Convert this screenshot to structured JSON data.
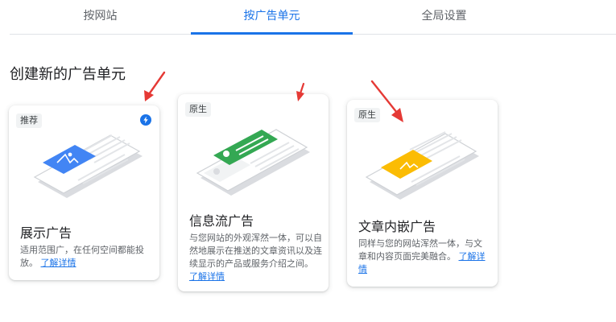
{
  "tabs": [
    {
      "label": "按网站"
    },
    {
      "label": "按广告单元"
    },
    {
      "label": "全局设置"
    }
  ],
  "section_title": "创建新的广告单元",
  "cards": [
    {
      "badge": "推荐",
      "title": "展示广告",
      "desc": "适用范围广，在任何空间都能投放。",
      "link": "了解详情",
      "icon": "lightning-bolt-icon"
    },
    {
      "badge": "原生",
      "title": "信息流广告",
      "desc": "与您网站的外观浑然一体，可以自然地展示在推送的文章资讯以及连续显示的产品或服务介绍之间。",
      "link": "了解详情"
    },
    {
      "badge": "原生",
      "title": "文章内嵌广告",
      "desc": "同样与您的网站浑然一体，与文章和内容页面完美融合。",
      "link": "了解详情"
    }
  ],
  "colors": {
    "accent": "#1a73e8",
    "display_ad": "#4285f4",
    "infeed_ad": "#34a853",
    "inarticle_ad": "#fbbc04",
    "annotation_arrow": "#e53935"
  }
}
